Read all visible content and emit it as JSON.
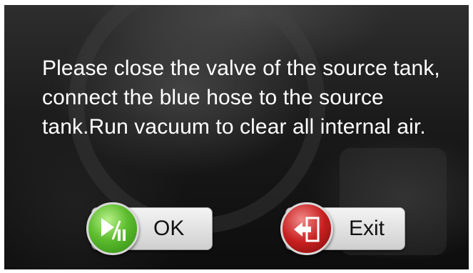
{
  "dialog": {
    "message": "Please close the valve of the source tank, connect the blue hose to the source tank.Run vacuum to clear all internal air."
  },
  "buttons": {
    "ok": {
      "label": "OK",
      "icon": "play-pause-icon"
    },
    "exit": {
      "label": "Exit",
      "icon": "exit-door-icon"
    }
  },
  "colors": {
    "ok_icon": "#4aa82a",
    "exit_icon": "#c8201f",
    "text": "#ffffff"
  }
}
